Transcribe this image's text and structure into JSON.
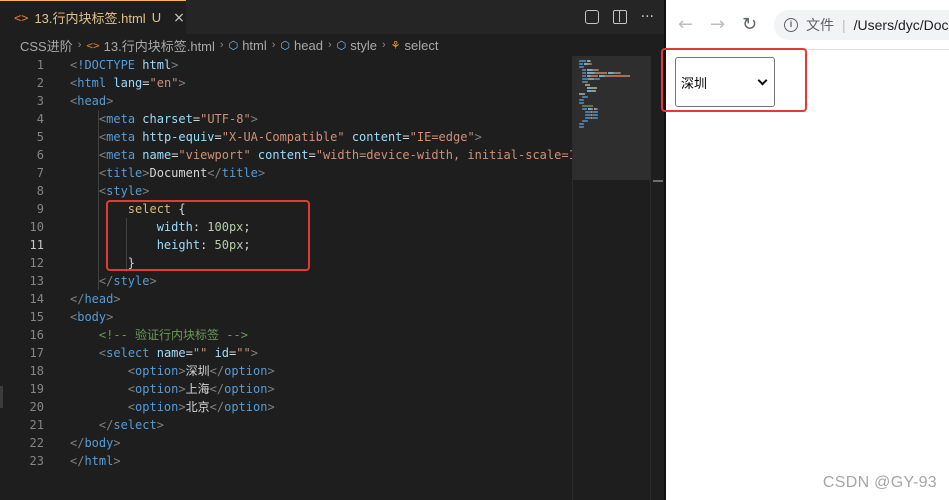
{
  "editor": {
    "tab": {
      "icon": "html-file-icon",
      "icon_glyph": "<>",
      "file_name": "13.行内块标签.html",
      "status": "U",
      "close_glyph": "×"
    },
    "actions": [
      "compare-changes-icon",
      "split-editor-icon",
      "more-actions-icon"
    ],
    "more_glyph": "···",
    "breadcrumb": [
      "CSS进阶",
      "13.行内块标签.html",
      "html",
      "head",
      "style",
      "select"
    ],
    "active_line": 11,
    "lines": [
      [
        [
          "t-br",
          "<"
        ],
        [
          "t-tag",
          "!DOCTYPE"
        ],
        [
          "t-text",
          " "
        ],
        [
          "t-attr",
          "html"
        ],
        [
          "t-br",
          ">"
        ]
      ],
      [
        [
          "t-br",
          "<"
        ],
        [
          "t-tag",
          "html"
        ],
        [
          "t-text",
          " "
        ],
        [
          "t-attr",
          "lang"
        ],
        [
          "t-text",
          "="
        ],
        [
          "t-str",
          "\"en\""
        ],
        [
          "t-br",
          ">"
        ]
      ],
      [
        [
          "t-br",
          "<"
        ],
        [
          "t-tag",
          "head"
        ],
        [
          "t-br",
          ">"
        ]
      ],
      [
        [
          "t-text",
          "    "
        ],
        [
          "t-br",
          "<"
        ],
        [
          "t-tag",
          "meta"
        ],
        [
          "t-text",
          " "
        ],
        [
          "t-attr",
          "charset"
        ],
        [
          "t-text",
          "="
        ],
        [
          "t-str",
          "\"UTF-8\""
        ],
        [
          "t-br",
          ">"
        ]
      ],
      [
        [
          "t-text",
          "    "
        ],
        [
          "t-br",
          "<"
        ],
        [
          "t-tag",
          "meta"
        ],
        [
          "t-text",
          " "
        ],
        [
          "t-attr",
          "http-equiv"
        ],
        [
          "t-text",
          "="
        ],
        [
          "t-str",
          "\"X-UA-Compatible\""
        ],
        [
          "t-text",
          " "
        ],
        [
          "t-attr",
          "content"
        ],
        [
          "t-text",
          "="
        ],
        [
          "t-str",
          "\"IE=edge\""
        ],
        [
          "t-br",
          ">"
        ]
      ],
      [
        [
          "t-text",
          "    "
        ],
        [
          "t-br",
          "<"
        ],
        [
          "t-tag",
          "meta"
        ],
        [
          "t-text",
          " "
        ],
        [
          "t-attr",
          "name"
        ],
        [
          "t-text",
          "="
        ],
        [
          "t-str",
          "\"viewport\""
        ],
        [
          "t-text",
          " "
        ],
        [
          "t-attr",
          "content"
        ],
        [
          "t-text",
          "="
        ],
        [
          "t-str",
          "\"width=device-width, initial-scale=1"
        ]
      ],
      [
        [
          "t-text",
          "    "
        ],
        [
          "t-br",
          "<"
        ],
        [
          "t-tag",
          "title"
        ],
        [
          "t-br",
          ">"
        ],
        [
          "t-text",
          "Document"
        ],
        [
          "t-br",
          "</"
        ],
        [
          "t-tag",
          "title"
        ],
        [
          "t-br",
          ">"
        ]
      ],
      [
        [
          "t-text",
          "    "
        ],
        [
          "t-br",
          "<"
        ],
        [
          "t-tag",
          "style"
        ],
        [
          "t-br",
          ">"
        ]
      ],
      [
        [
          "t-text",
          "        "
        ],
        [
          "t-sel",
          "select"
        ],
        [
          "t-text",
          " {"
        ]
      ],
      [
        [
          "t-text",
          "            "
        ],
        [
          "t-prop",
          "width"
        ],
        [
          "t-text",
          ": "
        ],
        [
          "t-num",
          "100px"
        ],
        [
          "t-text",
          ";"
        ]
      ],
      [
        [
          "t-text",
          "            "
        ],
        [
          "t-prop",
          "height"
        ],
        [
          "t-text",
          ": "
        ],
        [
          "t-num",
          "50px"
        ],
        [
          "t-text",
          ";"
        ]
      ],
      [
        [
          "t-text",
          "        }"
        ]
      ],
      [
        [
          "t-text",
          "    "
        ],
        [
          "t-br",
          "</"
        ],
        [
          "t-tag",
          "style"
        ],
        [
          "t-br",
          ">"
        ]
      ],
      [
        [
          "t-br",
          "</"
        ],
        [
          "t-tag",
          "head"
        ],
        [
          "t-br",
          ">"
        ]
      ],
      [
        [
          "t-br",
          "<"
        ],
        [
          "t-tag",
          "body"
        ],
        [
          "t-br",
          ">"
        ]
      ],
      [
        [
          "t-text",
          "    "
        ],
        [
          "t-cmt",
          "<!-- 验证行内块标签 -->"
        ]
      ],
      [
        [
          "t-text",
          "    "
        ],
        [
          "t-br",
          "<"
        ],
        [
          "t-tag",
          "select"
        ],
        [
          "t-text",
          " "
        ],
        [
          "t-attr",
          "name"
        ],
        [
          "t-text",
          "="
        ],
        [
          "t-str",
          "\"\""
        ],
        [
          "t-text",
          " "
        ],
        [
          "t-attr",
          "id"
        ],
        [
          "t-text",
          "="
        ],
        [
          "t-str",
          "\"\""
        ],
        [
          "t-br",
          ">"
        ]
      ],
      [
        [
          "t-text",
          "        "
        ],
        [
          "t-br",
          "<"
        ],
        [
          "t-tag",
          "option"
        ],
        [
          "t-br",
          ">"
        ],
        [
          "t-text",
          "深圳"
        ],
        [
          "t-br",
          "</"
        ],
        [
          "t-tag",
          "option"
        ],
        [
          "t-br",
          ">"
        ]
      ],
      [
        [
          "t-text",
          "        "
        ],
        [
          "t-br",
          "<"
        ],
        [
          "t-tag",
          "option"
        ],
        [
          "t-br",
          ">"
        ],
        [
          "t-text",
          "上海"
        ],
        [
          "t-br",
          "</"
        ],
        [
          "t-tag",
          "option"
        ],
        [
          "t-br",
          ">"
        ]
      ],
      [
        [
          "t-text",
          "        "
        ],
        [
          "t-br",
          "<"
        ],
        [
          "t-tag",
          "option"
        ],
        [
          "t-br",
          ">"
        ],
        [
          "t-text",
          "北京"
        ],
        [
          "t-br",
          "</"
        ],
        [
          "t-tag",
          "option"
        ],
        [
          "t-br",
          ">"
        ]
      ],
      [
        [
          "t-text",
          "    "
        ],
        [
          "t-br",
          "</"
        ],
        [
          "t-tag",
          "select"
        ],
        [
          "t-br",
          ">"
        ]
      ],
      [
        [
          "t-br",
          "</"
        ],
        [
          "t-tag",
          "body"
        ],
        [
          "t-br",
          ">"
        ]
      ],
      [
        [
          "t-br",
          "</"
        ],
        [
          "t-tag",
          "html"
        ],
        [
          "t-br",
          ">"
        ]
      ]
    ]
  },
  "browser": {
    "nav": {
      "back": "←",
      "forward": "→",
      "reload": "↻"
    },
    "info_glyph": "i",
    "scheme_label": "文件",
    "url": "/Users/dyc/Doc",
    "select": {
      "selected": "深圳"
    }
  },
  "watermark": "CSDN @GY-93",
  "colors": {
    "highlight": "#e53935",
    "editor_bg": "#1e1e1e",
    "browser_bg": "#ffffff"
  }
}
